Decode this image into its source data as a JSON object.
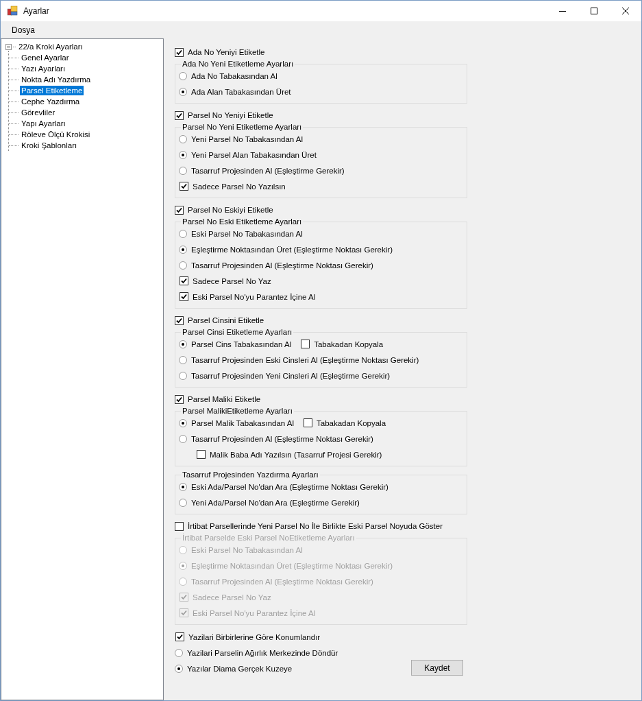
{
  "window": {
    "title": "Ayarlar"
  },
  "menu": [
    "Dosya"
  ],
  "tree": {
    "root": {
      "label": "22/a Kroki Ayarları",
      "expanded": true,
      "children": [
        {
          "label": "Genel Ayarlar",
          "selected": false
        },
        {
          "label": "Yazı Ayarları",
          "selected": false
        },
        {
          "label": "Nokta Adı Yazdırma",
          "selected": false
        },
        {
          "label": "Parsel Etiketleme",
          "selected": true
        },
        {
          "label": "Cephe Yazdırma",
          "selected": false
        },
        {
          "label": "Görevliler",
          "selected": false
        },
        {
          "label": "Yapı Ayarları",
          "selected": false
        },
        {
          "label": "Röleve Ölçü Krokisi",
          "selected": false
        },
        {
          "label": "Kroki Şablonları",
          "selected": false
        }
      ]
    }
  },
  "items": [
    {
      "kind": "checkbox",
      "label": "Ada No Yeniyi Etiketle",
      "checked": true
    },
    {
      "kind": "group",
      "title": "Ada No Yeni Etiketleme Ayarları",
      "disabled": false,
      "options": [
        {
          "kind": "radio",
          "label": "Ada No Tabakasından Al",
          "selected": false
        },
        {
          "kind": "radio",
          "label": "Ada Alan Tabakasından Üret",
          "selected": true
        }
      ]
    },
    {
      "kind": "checkbox",
      "label": "Parsel No Yeniyi Etiketle",
      "checked": true
    },
    {
      "kind": "group",
      "title": "Parsel No Yeni Etiketleme Ayarları",
      "disabled": false,
      "options": [
        {
          "kind": "radio",
          "label": "Yeni Parsel No Tabakasından Al",
          "selected": false
        },
        {
          "kind": "radio",
          "label": "Yeni Parsel Alan Tabakasından Üret",
          "selected": true
        },
        {
          "kind": "radio",
          "label": "Tasarruf Projesinden Al (Eşleştirme Gerekir)",
          "selected": false
        },
        {
          "kind": "checkbox",
          "label": "Sadece Parsel No Yazılsın",
          "checked": true
        }
      ]
    },
    {
      "kind": "checkbox",
      "label": "Parsel No Eskiyi Etiketle",
      "checked": true
    },
    {
      "kind": "group",
      "title": "Parsel No Eski Etiketleme Ayarları",
      "disabled": false,
      "options": [
        {
          "kind": "radio",
          "label": "Eski Parsel No Tabakasından Al",
          "selected": false
        },
        {
          "kind": "radio",
          "label": "Eşleştirme Noktasından Üret (Eşleştirme Noktası Gerekir)",
          "selected": true
        },
        {
          "kind": "radio",
          "label": "Tasarruf Projesinden Al (Eşleştirme Noktası Gerekir)",
          "selected": false
        },
        {
          "kind": "checkbox",
          "label": "Sadece Parsel No Yaz",
          "checked": true
        },
        {
          "kind": "checkbox",
          "label": "Eski Parsel No'yu Parantez İçine Al",
          "checked": true
        }
      ]
    },
    {
      "kind": "checkbox",
      "label": "Parsel Cinsini Etiketle",
      "checked": true
    },
    {
      "kind": "group",
      "title": "Parsel Cinsi Etiketleme Ayarları",
      "disabled": false,
      "options": [
        {
          "kind": "radio",
          "label": "Parsel Cins Tabakasından Al",
          "selected": true,
          "extra": {
            "label": "Tabakadan Kopyala",
            "checked": false
          }
        },
        {
          "kind": "radio",
          "label": "Tasarruf Projesinden Eski Cinsleri Al (Eşleştirme Noktası Gerekir)",
          "selected": false
        },
        {
          "kind": "radio",
          "label": "Tasarruf Projesinden Yeni Cinsleri Al (Eşleştirme Gerekir)",
          "selected": false
        }
      ]
    },
    {
      "kind": "checkbox",
      "label": "Parsel Maliki Etiketle",
      "checked": true
    },
    {
      "kind": "group",
      "title": "Parsel MalikiEtiketleme Ayarları",
      "disabled": false,
      "options": [
        {
          "kind": "radio",
          "label": "Parsel Malik Tabakasından Al",
          "selected": true,
          "extra": {
            "label": "Tabakadan Kopyala",
            "checked": false
          }
        },
        {
          "kind": "radio",
          "label": "Tasarruf Projesinden Al (Eşleştirme Noktası Gerekir)",
          "selected": false
        },
        {
          "kind": "subcheckbox",
          "label": "Malik Baba Adı Yazılsın (Tasarruf Projesi Gerekir)",
          "checked": false
        }
      ]
    },
    {
      "kind": "group",
      "title": "Tasarruf Projesinden Yazdırma Ayarları",
      "disabled": false,
      "options": [
        {
          "kind": "radio",
          "label": "Eski Ada/Parsel No'dan Ara (Eşleştirme Noktası Gerekir)",
          "selected": true
        },
        {
          "kind": "radio",
          "label": "Yeni Ada/Parsel No'dan Ara (Eşleştirme Gerekir)",
          "selected": false
        }
      ]
    },
    {
      "kind": "checkbox",
      "label": "İrtibat Parsellerinde Yeni Parsel No İle Birlikte Eski Parsel Noyuda Göster",
      "checked": false
    },
    {
      "kind": "group",
      "title": "İrtibat Parselde Eski Parsel NoEtiketleme Ayarları",
      "disabled": true,
      "options": [
        {
          "kind": "radio",
          "label": "Eski Parsel No Tabakasından Al",
          "selected": false
        },
        {
          "kind": "radio",
          "label": "Eşleştirme Noktasından Üret (Eşleştirme Noktası Gerekir)",
          "selected": true
        },
        {
          "kind": "radio",
          "label": "Tasarruf Projesinden Al (Eşleştirme Noktası Gerekir)",
          "selected": false
        },
        {
          "kind": "checkbox",
          "label": "Sadece Parsel No Yaz",
          "checked": true
        },
        {
          "kind": "checkbox",
          "label": "Eski Parsel No'yu Parantez İçine Al",
          "checked": true
        }
      ]
    }
  ],
  "bottom_options": [
    {
      "kind": "checkbox",
      "label": "Yazilari Birbirlerine Göre Konumlandır",
      "checked": true
    },
    {
      "kind": "radio",
      "label": "Yazilari Parselin Ağırlık Merkezinde Döndür",
      "selected": false
    },
    {
      "kind": "radio",
      "label": "Yazılar Diama Gerçek Kuzeye",
      "selected": true
    }
  ],
  "save_button": "Kaydet"
}
